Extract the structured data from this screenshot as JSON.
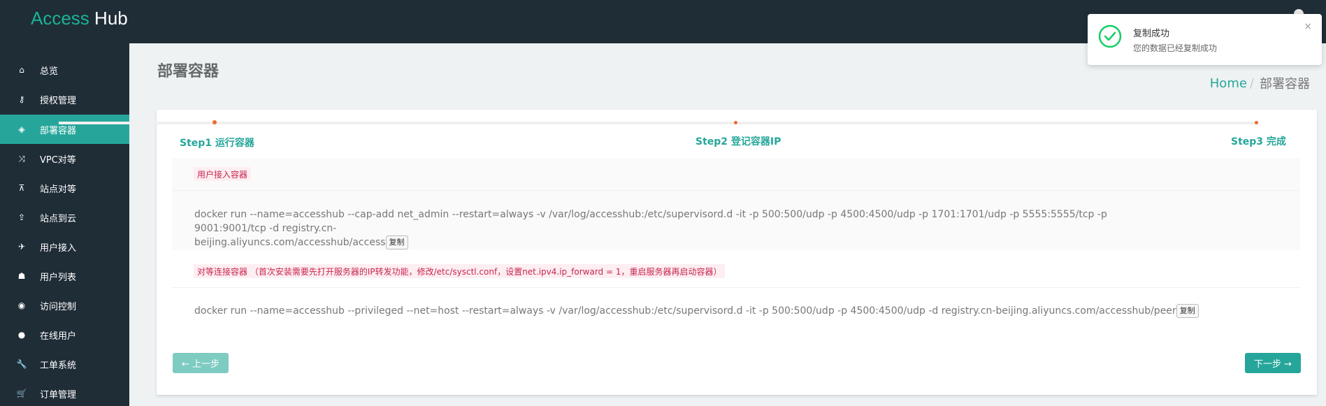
{
  "brand": {
    "part1": "Access",
    "part2": "Hub"
  },
  "sidebar": {
    "items": [
      {
        "label": "总览",
        "icon": "home-icon",
        "glyph": "⌂",
        "active": false
      },
      {
        "label": "授权管理",
        "icon": "key-icon",
        "glyph": "⚷",
        "active": false
      },
      {
        "label": "部署容器",
        "icon": "cube-icon",
        "glyph": "◈",
        "active": true
      },
      {
        "label": "VPC对等",
        "icon": "random-icon",
        "glyph": "⤨",
        "active": false
      },
      {
        "label": "站点对等",
        "icon": "sitemap-icon",
        "glyph": "⊼",
        "active": false
      },
      {
        "label": "站点到云",
        "icon": "upload-icon",
        "glyph": "⇪",
        "active": false
      },
      {
        "label": "用户接入",
        "icon": "plane-icon",
        "glyph": "✈",
        "active": false
      },
      {
        "label": "用户列表",
        "icon": "users-icon",
        "glyph": "☗",
        "active": false
      },
      {
        "label": "访问控制",
        "icon": "circle-icon",
        "glyph": "◉",
        "active": false
      },
      {
        "label": "在线用户",
        "icon": "user-icon",
        "glyph": "●",
        "active": false
      },
      {
        "label": "工单系统",
        "icon": "wrench-icon",
        "glyph": "🔧",
        "active": false
      },
      {
        "label": "订单管理",
        "icon": "cart-icon",
        "glyph": "🛒",
        "active": false
      }
    ]
  },
  "page": {
    "title": "部署容器"
  },
  "breadcrumb": {
    "home": "Home",
    "separator": "/",
    "current": "部署容器"
  },
  "steps": [
    {
      "label": "Step1 运行容器"
    },
    {
      "label": "Step2 登记容器IP"
    },
    {
      "label": "Step3 完成"
    }
  ],
  "sections": {
    "user": {
      "tag": "用户接入容器",
      "command_line1": "docker run --name=accesshub --cap-add net_admin --restart=always -v /var/log/accesshub:/etc/supervisord.d -it -p 500:500/udp -p 4500:4500/udp -p 1701:1701/udp -p 5555:5555/tcp -p 9001:9001/tcp -d registry.cn-",
      "command_line2": "beijing.aliyuncs.com/accesshub/access",
      "copy_label": "复制"
    },
    "peer": {
      "tag": "对等连接容器 （首次安装需要先打开服务器的IP转发功能，修改/etc/sysctl.conf，设置net.ipv4.ip_forward = 1，重启服务器再启动容器）",
      "command": "docker run --name=accesshub --privileged --net=host --restart=always -v /var/log/accesshub:/etc/supervisord.d -it -p 500:500/udp -p 4500:4500/udp -d registry.cn-beijing.aliyuncs.com/accesshub/peer",
      "copy_label": "复制"
    }
  },
  "buttons": {
    "prev": "← 上一步",
    "next": "下一步 →"
  },
  "toast": {
    "title": "复制成功",
    "message": "您的数据已经复制成功",
    "close": "×",
    "icon": "check-circle-icon"
  },
  "colors": {
    "accent": "#26a69a",
    "sidebar_bg": "#1f2d37",
    "tag_text": "#c7254e",
    "step_dot": "#ee6a2a",
    "success": "#13ce66"
  }
}
